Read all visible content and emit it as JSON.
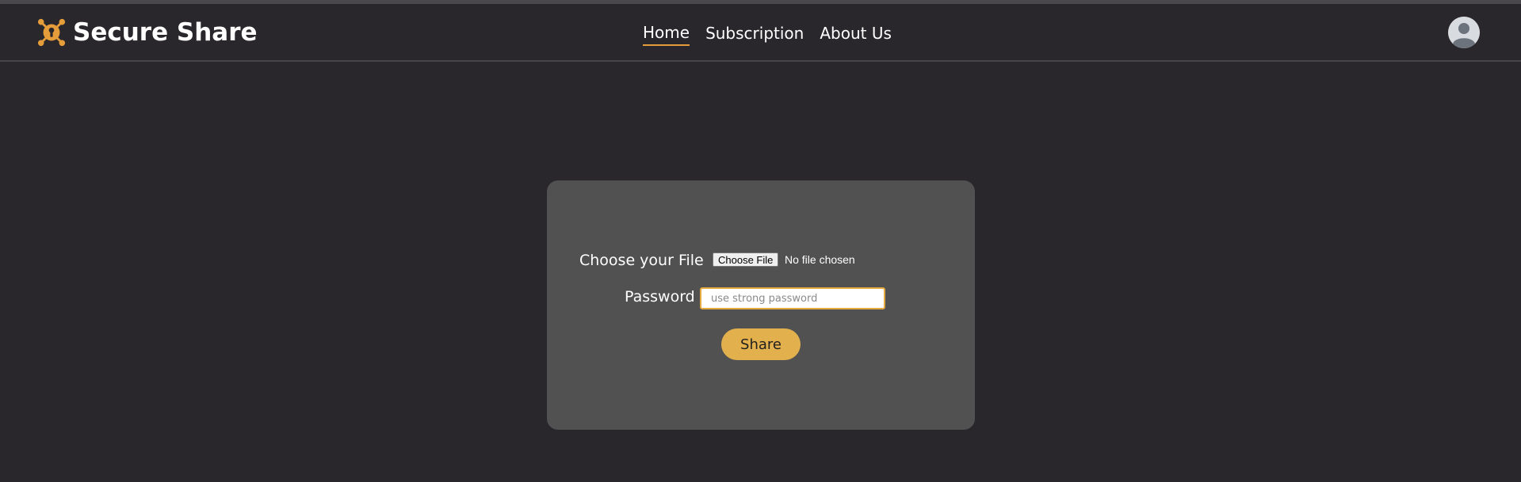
{
  "brand": {
    "name": "Secure Share",
    "icon": "keyhole-network-icon",
    "icon_color": "#e59d3b"
  },
  "nav": {
    "items": [
      {
        "label": "Home",
        "active": true
      },
      {
        "label": "Subscription",
        "active": false
      },
      {
        "label": "About Us",
        "active": false
      }
    ]
  },
  "user": {
    "avatar_icon": "user-avatar-icon"
  },
  "form": {
    "file_label": "Choose your File",
    "file_button": "Choose File",
    "file_status": "No file chosen",
    "password_label": "Password",
    "password_placeholder": "use strong password",
    "submit_label": "Share"
  },
  "colors": {
    "background": "#29272b",
    "card": "#515151",
    "accent": "#e2b14d",
    "nav_underline": "#e59d3b"
  }
}
